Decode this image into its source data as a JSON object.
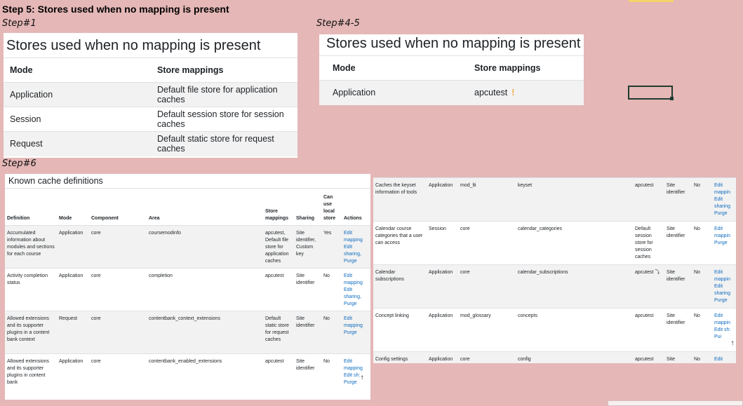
{
  "step_heading": "Step 5: Stores used when no mapping is present",
  "labels": {
    "step1": "Step#1",
    "step45": "Step#4-5",
    "step6": "Step#6"
  },
  "panel1": {
    "title": "Stores used when no mapping is present",
    "col_mode": "Mode",
    "col_store": "Store mappings",
    "rows": [
      {
        "mode": "Application",
        "store": "Default file store for application caches"
      },
      {
        "mode": "Session",
        "store": "Default session store for session caches"
      },
      {
        "mode": "Request",
        "store": "Default static store for request caches"
      }
    ]
  },
  "panel2": {
    "title": "Stores used when no mapping is present",
    "col_mode": "Mode",
    "col_store": "Store mappings",
    "rows": [
      {
        "mode": "Application",
        "store": "apcutest",
        "warn": "!"
      }
    ]
  },
  "kcd_left": {
    "title": "Known cache definitions",
    "headers": {
      "definition": "Definition",
      "mode": "Mode",
      "component": "Component",
      "area": "Area",
      "store": "Store mappings",
      "sharing": "Sharing",
      "local": "Can use local store",
      "actions": "Actions"
    },
    "rows": [
      {
        "definition": "Accumulated information about modules and sections for each course",
        "mode": "Application",
        "component": "core",
        "area": "coursemodinfo",
        "store": "apcutest, Default file store for application caches",
        "sharing": "Site identifier, Custom key",
        "local": "Yes",
        "actions": [
          "Edit mapping",
          "Edit sharing,",
          "Purge"
        ]
      },
      {
        "definition": "Activity completion status",
        "mode": "Application",
        "component": "core",
        "area": "completion",
        "store": "apcutest",
        "sharing": "Site identifier",
        "local": "No",
        "actions": [
          "Edit mapping",
          "Edit sharing,",
          "Purge"
        ]
      },
      {
        "definition": "Allowed extensions and its supporter plugins in a content bank context",
        "mode": "Request",
        "component": "core",
        "area": "contentbank_context_extensions",
        "store": "Default static store for request caches",
        "sharing": "Site identifier",
        "local": "No",
        "actions": [
          "Edit mapping",
          "Purge"
        ]
      },
      {
        "definition": "Allowed extensions and its supporter plugins in content bank",
        "mode": "Application",
        "component": "core",
        "area": "contentbank_enabled_extensions",
        "store": "apcutest",
        "sharing": "Site identifier",
        "local": "No",
        "actions": [
          "Edit mapping",
          "Edit sh:",
          "Purge"
        ]
      }
    ],
    "scroll_icon": "↑"
  },
  "kcd_right": {
    "rows": [
      {
        "definition": "Caches the keyset information of tools",
        "mode": "Application",
        "component": "mod_lti",
        "area": "keyset",
        "store": "apcutest",
        "sharing": "Site identifier",
        "local": "No",
        "actions": [
          "Edit mappin",
          "Edit sharing",
          "Purge"
        ]
      },
      {
        "definition": "Calendar course categories that a user can access",
        "mode": "Session",
        "component": "core",
        "area": "calendar_categories",
        "store": "Default session store for session caches",
        "sharing": "Site identifier",
        "local": "No",
        "actions": [
          "Edit mappin",
          "Purge"
        ]
      },
      {
        "definition": "Calendar subscriptions",
        "mode": "Application",
        "component": "core",
        "area": "calendar_subscriptions",
        "store": "apcutest ⤵",
        "sharing": "Site identifier",
        "local": "No",
        "actions": [
          "Edit mappin",
          "Edit sharing",
          "Purge"
        ]
      },
      {
        "definition": "Concept linking",
        "mode": "Application",
        "component": "mod_glossary",
        "area": "concepts",
        "store": "apcutest",
        "sharing": "Site identifier",
        "local": "No",
        "actions": [
          "Edit mappin",
          "Edit sh:",
          "Pui"
        ]
      },
      {
        "definition": "Config settings",
        "mode": "Application",
        "component": "core",
        "area": "config",
        "store": "apcutest",
        "sharing": "Site",
        "local": "No",
        "actions": [
          "Edit"
        ]
      }
    ],
    "scroll_icon": "↑"
  }
}
